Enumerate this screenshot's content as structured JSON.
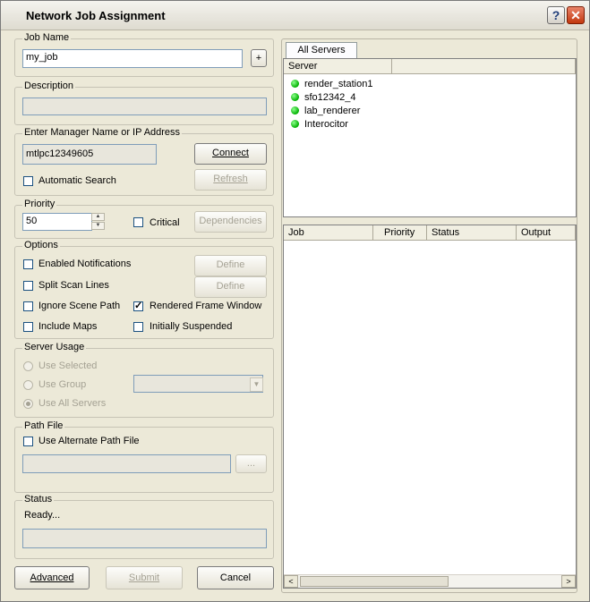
{
  "window": {
    "title": "Network Job Assignment",
    "help_glyph": "?",
    "close_glyph": "✕"
  },
  "job_name": {
    "legend": "Job Name",
    "value": "my_job",
    "plus_label": "+"
  },
  "description": {
    "legend": "Description",
    "value": ""
  },
  "manager": {
    "legend": "Enter Manager Name or IP Address",
    "value": "mtlpc12349605",
    "connect_label": "Connect",
    "refresh_label": "Refresh",
    "auto_search_label": "Automatic Search",
    "auto_search_checked": false
  },
  "priority": {
    "legend": "Priority",
    "value": "50",
    "critical_label": "Critical",
    "critical_checked": false,
    "dependencies_label": "Dependencies"
  },
  "options": {
    "legend": "Options",
    "enabled_notifications": {
      "label": "Enabled Notifications",
      "checked": false
    },
    "split_scan_lines": {
      "label": "Split Scan Lines",
      "checked": false
    },
    "ignore_scene_path": {
      "label": "Ignore Scene Path",
      "checked": false
    },
    "rendered_frame_window": {
      "label": "Rendered Frame Window",
      "checked": true
    },
    "include_maps": {
      "label": "Include Maps",
      "checked": false
    },
    "initially_suspended": {
      "label": "Initially Suspended",
      "checked": false
    },
    "define_label_1": "Define",
    "define_label_2": "Define"
  },
  "server_usage": {
    "legend": "Server Usage",
    "use_selected": "Use Selected",
    "use_group": "Use Group",
    "use_all_servers": "Use All Servers",
    "selected_option": "use_all_servers",
    "group_value": ""
  },
  "path_file": {
    "legend": "Path File",
    "use_alternate_label": "Use Alternate Path File",
    "use_alternate_checked": false,
    "value": "",
    "browse_label": "..."
  },
  "status": {
    "legend": "Status",
    "text": "Ready...",
    "bar_value": ""
  },
  "buttons": {
    "advanced": "Advanced",
    "submit": "Submit",
    "cancel": "Cancel"
  },
  "servers": {
    "tab_label": "All Servers",
    "column_server": "Server",
    "items": [
      {
        "name": "render_station1",
        "status_color": "#00c000"
      },
      {
        "name": "sfo12342_4",
        "status_color": "#00c000"
      },
      {
        "name": "lab_renderer",
        "status_color": "#00c000"
      },
      {
        "name": "Interocitor",
        "status_color": "#00c000"
      }
    ]
  },
  "jobs": {
    "columns": [
      "Job",
      "Priority",
      "Status",
      "Output"
    ],
    "rows": []
  },
  "scrollbar": {
    "left_glyph": "<",
    "right_glyph": ">"
  }
}
